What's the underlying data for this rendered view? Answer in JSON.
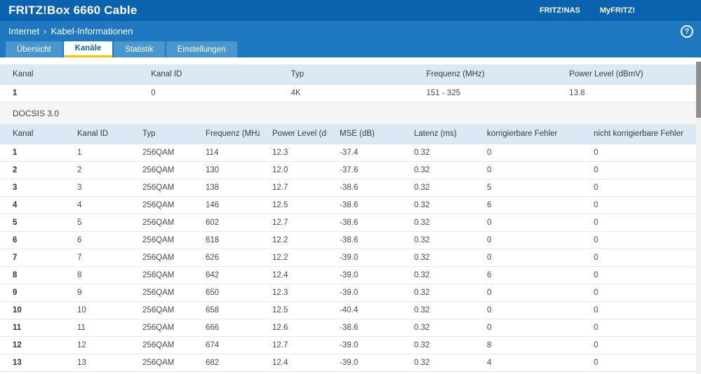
{
  "header": {
    "title": "FRITZ!Box 6660 Cable",
    "links": [
      {
        "label": "FRITZ!NAS"
      },
      {
        "label": "MyFRITZ!"
      }
    ]
  },
  "breadcrumb": {
    "section": "Internet",
    "separator": "›",
    "page": "Kabel-Informationen",
    "help_icon": "?"
  },
  "tabs": [
    {
      "label": "Übersicht",
      "active": false
    },
    {
      "label": "Kanäle",
      "active": true
    },
    {
      "label": "Statistik",
      "active": false
    },
    {
      "label": "Einstellungen",
      "active": false
    }
  ],
  "docsis31_table": {
    "headers": [
      "Kanal",
      "Kanal ID",
      "Typ",
      "Frequenz (MHz)",
      "Power Level (dBmV)"
    ],
    "rows": [
      [
        "1",
        "0",
        "4K",
        "151 - 325",
        "13.8"
      ]
    ]
  },
  "section_label": "DOCSIS 3.0",
  "docsis30_table": {
    "headers": [
      "Kanal",
      "Kanal ID",
      "Typ",
      "Frequenz (MHz)",
      "Power Level (dBmV)",
      "MSE (dB)",
      "Latenz (ms)",
      "korrigierbare Fehler",
      "nicht korrigierbare Fehler"
    ],
    "rows": [
      [
        "1",
        "1",
        "256QAM",
        "114",
        "12.3",
        "-37.4",
        "0.32",
        "0",
        "0"
      ],
      [
        "2",
        "2",
        "256QAM",
        "130",
        "12.0",
        "-37.6",
        "0.32",
        "0",
        "0"
      ],
      [
        "3",
        "3",
        "256QAM",
        "138",
        "12.7",
        "-38.6",
        "0.32",
        "5",
        "0"
      ],
      [
        "4",
        "4",
        "256QAM",
        "146",
        "12.5",
        "-38.6",
        "0.32",
        "6",
        "0"
      ],
      [
        "5",
        "5",
        "256QAM",
        "602",
        "12.7",
        "-38.6",
        "0.32",
        "0",
        "0"
      ],
      [
        "6",
        "6",
        "256QAM",
        "618",
        "12.2",
        "-38.6",
        "0.32",
        "0",
        "0"
      ],
      [
        "7",
        "7",
        "256QAM",
        "626",
        "12.2",
        "-39.0",
        "0.32",
        "0",
        "0"
      ],
      [
        "8",
        "8",
        "256QAM",
        "642",
        "12.4",
        "-39.0",
        "0.32",
        "6",
        "0"
      ],
      [
        "9",
        "9",
        "256QAM",
        "650",
        "12.3",
        "-39.0",
        "0.32",
        "0",
        "0"
      ],
      [
        "10",
        "10",
        "256QAM",
        "658",
        "12.5",
        "-40.4",
        "0.32",
        "0",
        "0"
      ],
      [
        "11",
        "11",
        "256QAM",
        "666",
        "12.6",
        "-38.6",
        "0.32",
        "0",
        "0"
      ],
      [
        "12",
        "12",
        "256QAM",
        "674",
        "12.7",
        "-39.0",
        "0.32",
        "8",
        "0"
      ],
      [
        "13",
        "13",
        "256QAM",
        "682",
        "12.4",
        "-39.0",
        "0.32",
        "4",
        "0"
      ]
    ]
  },
  "colors": {
    "topbar_blue": "#0b62ae",
    "bar_blue": "#1e79c0",
    "tab_inactive_blue": "#4a97d0",
    "active_tab_underline": "#f3c200",
    "active_tab_text": "#15649f",
    "table_header_bg": "#dbe9f5",
    "row_border": "#e7e7e7",
    "section_bg": "#f5f5f5"
  }
}
